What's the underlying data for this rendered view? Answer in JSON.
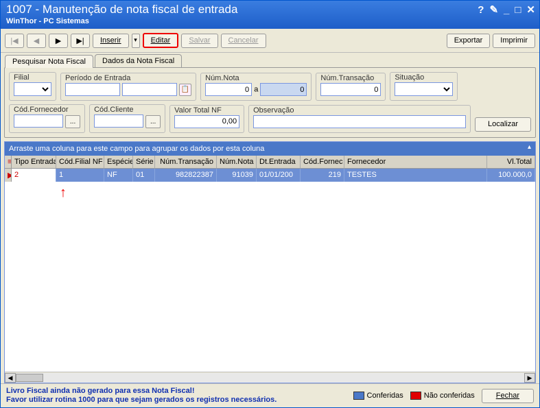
{
  "window": {
    "title": "1007 - Manutenção de nota fiscal de entrada",
    "subtitle": "WinThor - PC Sistemas"
  },
  "toolbar": {
    "first": "|◀",
    "prev": "◀",
    "next": "▶",
    "last": "▶|",
    "inserir": "Inserir",
    "editar": "Editar",
    "salvar": "Salvar",
    "cancelar": "Cancelar",
    "exportar": "Exportar",
    "imprimir": "Imprimir"
  },
  "tabs": {
    "pesquisar": "Pesquisar Nota Fiscal",
    "dados": "Dados da Nota Fiscal"
  },
  "filters": {
    "filial": {
      "label": "Filial",
      "value": ""
    },
    "periodo": {
      "label": "Período de Entrada",
      "de": "",
      "ate": ""
    },
    "num_nota": {
      "label": "Núm.Nota",
      "de": "0",
      "a_label": "a",
      "ate": "0"
    },
    "num_trans": {
      "label": "Núm.Transação",
      "value": "0"
    },
    "situacao": {
      "label": "Situação",
      "value": ""
    },
    "cod_fornec": {
      "label": "Cód.Fornecedor",
      "value": ""
    },
    "cod_cliente": {
      "label": "Cód.Cliente",
      "value": ""
    },
    "valor_total": {
      "label": "Valor Total NF",
      "value": "0,00"
    },
    "observacao": {
      "label": "Observação",
      "value": ""
    },
    "localizar": "Localizar"
  },
  "grid": {
    "group_hint": "Arraste uma coluna para este campo para agrupar os dados por esta coluna",
    "headers": {
      "tipo": "Tipo Entrada",
      "filial": "Cód.Filial NF",
      "especie": "Espécie",
      "serie": "Série",
      "trans": "Núm.Transação",
      "nota": "Núm.Nota",
      "dt": "Dt.Entrada",
      "codfornec": "Cód.Fornec",
      "fornecedor": "Fornecedor",
      "vl": "Vl.Total"
    },
    "rows": [
      {
        "tipo": "2",
        "filial": "1",
        "especie": "NF",
        "serie": "01",
        "trans": "982822387",
        "nota": "91039",
        "dt": "01/01/200",
        "codfornec": "219",
        "fornecedor": "TESTES",
        "vl": "100.000,0"
      }
    ]
  },
  "footer": {
    "msg1": "Livro Fiscal ainda não gerado para essa Nota Fiscal!",
    "msg2": "Favor utilizar rotina 1000 para que sejam gerados os registros necessários.",
    "conferidas": "Conferidas",
    "nao_conferidas": "Não conferidas",
    "fechar": "Fechar"
  },
  "colors": {
    "conferidas": "#4a78c8",
    "nao_conferidas": "#e00000"
  }
}
